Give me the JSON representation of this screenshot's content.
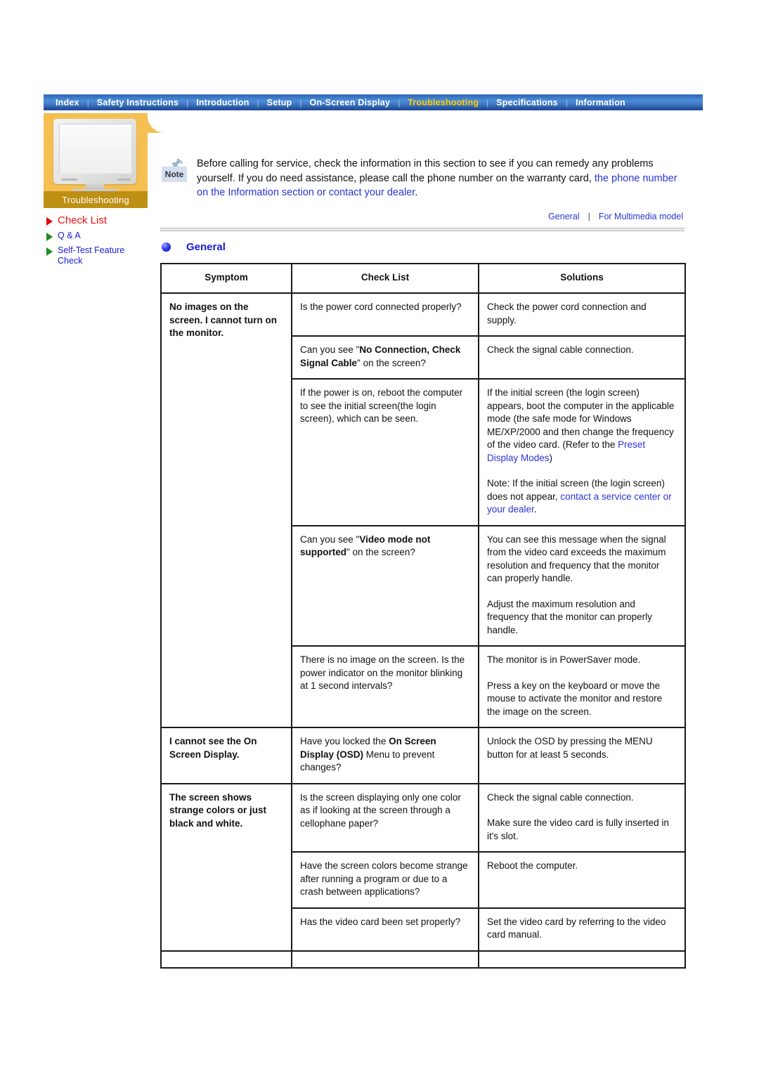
{
  "nav": {
    "items": [
      {
        "label": "Index",
        "active": false
      },
      {
        "label": "Safety Instructions",
        "active": false
      },
      {
        "label": "Introduction",
        "active": false
      },
      {
        "label": "Setup",
        "active": false
      },
      {
        "label": "On-Screen Display",
        "active": false
      },
      {
        "label": "Troubleshooting",
        "active": true
      },
      {
        "label": "Specifications",
        "active": false
      },
      {
        "label": "Information",
        "active": false
      }
    ],
    "separator": "|",
    "active_color": "#ffcc00",
    "text_color": "#ffffff",
    "bar_color": "#3d76c0"
  },
  "sidebar": {
    "card_label": "Troubleshooting",
    "card_bg": "#f5bf52",
    "label_bg": "#bd8f13",
    "monitor_icon": "crt-monitor-image",
    "items": [
      {
        "label": "Check List",
        "active": true,
        "color": "#ee1111",
        "arrow": "red-triangle-icon"
      },
      {
        "label": "Q & A",
        "active": false,
        "color": "#1a1ad6",
        "arrow": "green-triangle-icon"
      },
      {
        "label": "Self-Test Feature Check",
        "active": false,
        "color": "#1a1ad6",
        "arrow": "green-triangle-icon"
      }
    ]
  },
  "note": {
    "icon_label": "Note",
    "icon": "pushpin-note-icon",
    "text_plain_1": "Before calling for service, check the information in this section to see if you can remedy any problems yourself. If you do need assistance, please call the phone number on the warranty card, ",
    "text_link": "the phone number on the Information section or contact your dealer",
    "text_plain_2": "."
  },
  "section_links": {
    "left": "General",
    "separator": "|",
    "right": "For Multimedia model",
    "color": "#2b34d4"
  },
  "section": {
    "heading": "General",
    "bullet": "blue-sphere-bullet-icon",
    "heading_color": "#1a1ad6"
  },
  "table": {
    "headers": [
      "Symptom",
      "Check List",
      "Solutions"
    ],
    "rows": [
      {
        "symptom": "No images on the screen. I cannot turn on the monitor.",
        "symptom_rowspan": 5,
        "check": "Is the power cord connected properly?",
        "solution": "Check the power cord connection and supply."
      },
      {
        "check_pre": "Can you see \"",
        "check_bold": "No Connection, Check Signal Cable",
        "check_post": "\" on the screen?",
        "solution": "Check the signal cable connection."
      },
      {
        "check": "If the power is on, reboot the computer to see the initial screen(the login screen), which can be seen.",
        "solution_p1": "If the initial screen (the login screen) appears, boot the computer in the applicable mode (the safe mode for Windows ME/XP/2000 and",
        "solution_p2": "then change the frequency of the video card.",
        "solution_p3_pre": "(Refer to the ",
        "solution_p3_link": "Preset Display Modes",
        "solution_p3_post": ")",
        "solution_p4_pre": "Note: If the initial screen (the login screen) does not appear, ",
        "solution_p4_link": "contact a service center or your dealer",
        "solution_p4_post": "."
      },
      {
        "check_pre": "Can you see \"",
        "check_bold": "Video mode not supported",
        "check_post": "\" on the screen?",
        "solution_p1": "You can see this message when the signal from the video card exceeds the maximum resolution and frequency that the monitor can properly handle.",
        "solution_p2": "Adjust the maximum resolution and frequency that the monitor can properly handle."
      },
      {
        "check": "There is no image on the screen. Is the power indicator on the monitor blinking at 1 second intervals?",
        "solution_p1": "The monitor is in PowerSaver mode.",
        "solution_p2": "Press a key on the keyboard or move the mouse to activate the monitor and restore the image on the screen."
      },
      {
        "symptom": "I cannot see the On Screen Display.",
        "symptom_rowspan": 1,
        "check_pre": "Have you locked the ",
        "check_bold": "On Screen Display (OSD)",
        "check_post": " Menu to prevent changes?",
        "solution": "Unlock the OSD by pressing the MENU button for at least 5 seconds."
      },
      {
        "symptom": "The screen shows strange colors or just black and white.",
        "symptom_rowspan": 3,
        "check": "Is the screen displaying only one color as if looking at the screen through a cellophane paper?",
        "solution_p1": "Check the signal cable connection.",
        "solution_p2": "Make sure the video card is fully inserted in it's slot."
      },
      {
        "check": "Have the screen colors become strange after running a program or due to a crash between applications?",
        "solution": "Reboot the computer."
      },
      {
        "check": "Has the video card been set properly?",
        "solution": "Set the video card by referring to the video card manual."
      },
      {
        "check": "",
        "solution": ""
      }
    ]
  }
}
